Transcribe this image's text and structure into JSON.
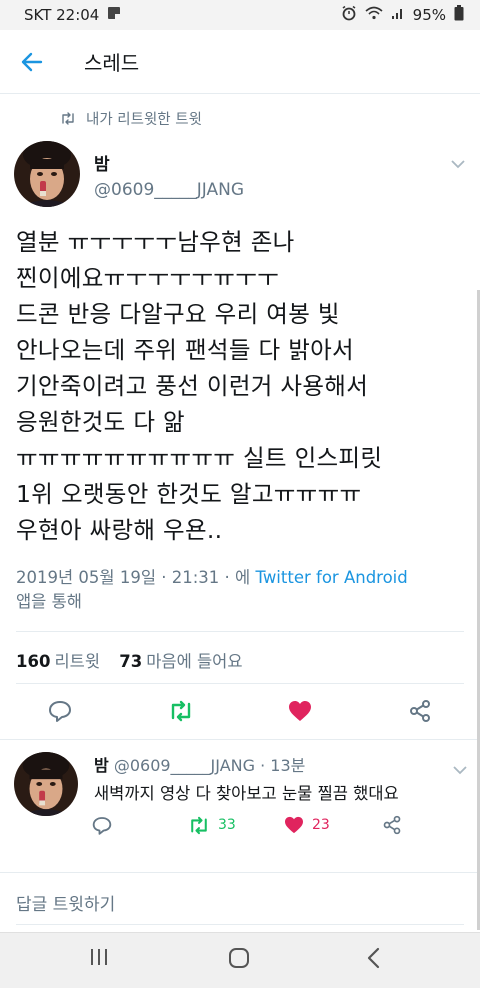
{
  "status_bar": {
    "carrier_time": "SKT 22:04",
    "battery": "95%"
  },
  "app_bar": {
    "title": "스레드"
  },
  "retweet_note": "내가 리트윗한 트윗",
  "tweet": {
    "name": "밤",
    "handle": "@0609_____JJANG",
    "lines": [
      "열분 ㅠㅜㅜㅜㅜ남우현 존나",
      "찐이에요ㅠㅜㅜㅜㅜㅠㅜㅜ",
      "드콘 반응 다알구요 우리 여봉 빛",
      "안나오는데 주위 팬석들 다 밝아서",
      "기안죽이려고 풍선 이런거 사용해서",
      "응원한것도 다 앎",
      "ㅠㅠㅠㅠㅠㅠㅠㅠㅠㅠ 실트 인스피릿",
      "1위 오랫동안 한것도 알고ㅠㅠㅠㅠ",
      "우현아 싸랑해 우욘.."
    ],
    "meta_date": "2019년 05월 19일 · 21:31 · 에",
    "meta_source": "Twitter for Android",
    "meta_suffix": "앱을 통해",
    "retweets_count": "160",
    "retweets_label": "리트윗",
    "likes_count": "73",
    "likes_label": "마음에 들어요"
  },
  "reply": {
    "name": "밤",
    "handle_time": "@0609_____JJANG · 13분",
    "text": "새벽까지 영상 다 찾아보고 눈물 찔끔 했대요",
    "retweets": "33",
    "likes": "23"
  },
  "compose_placeholder": "답글 트윗하기",
  "colors": {
    "accent": "#1b95e0",
    "retweet_green": "#17bf63",
    "like_red": "#e0245e",
    "secondary_text": "#657786"
  }
}
